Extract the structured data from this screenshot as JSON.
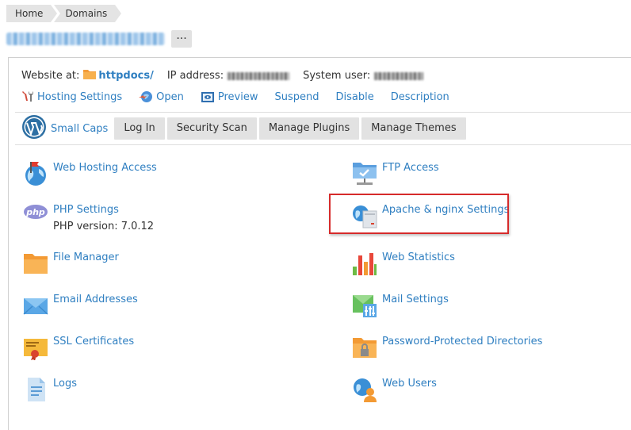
{
  "breadcrumb": [
    "Home",
    "Domains"
  ],
  "domain": {
    "more_label": "···"
  },
  "info": {
    "website_label": "Website at:",
    "website_folder": "httpdocs/",
    "ip_label": "IP address:",
    "user_label": "System user:"
  },
  "actions": {
    "hosting_settings": "Hosting Settings",
    "open": "Open",
    "preview": "Preview",
    "suspend": "Suspend",
    "disable": "Disable",
    "description": "Description"
  },
  "wordpress": {
    "site_name": "Small Caps",
    "login": "Log In",
    "security_scan": "Security Scan",
    "manage_plugins": "Manage Plugins",
    "manage_themes": "Manage Themes"
  },
  "tools": {
    "web_hosting_access": "Web Hosting Access",
    "ftp_access": "FTP Access",
    "php_settings": "PHP Settings",
    "php_version": "PHP version: 7.0.12",
    "apache_nginx": "Apache & nginx Settings",
    "file_manager": "File Manager",
    "web_statistics": "Web Statistics",
    "email_addresses": "Email Addresses",
    "mail_settings": "Mail Settings",
    "ssl_certificates": "SSL Certificates",
    "password_protected": "Password-Protected Directories",
    "logs": "Logs",
    "web_users": "Web Users"
  },
  "colors": {
    "link": "#2f7fc1",
    "highlight": "#d62b2b",
    "button_bg": "#e2e2e2"
  }
}
